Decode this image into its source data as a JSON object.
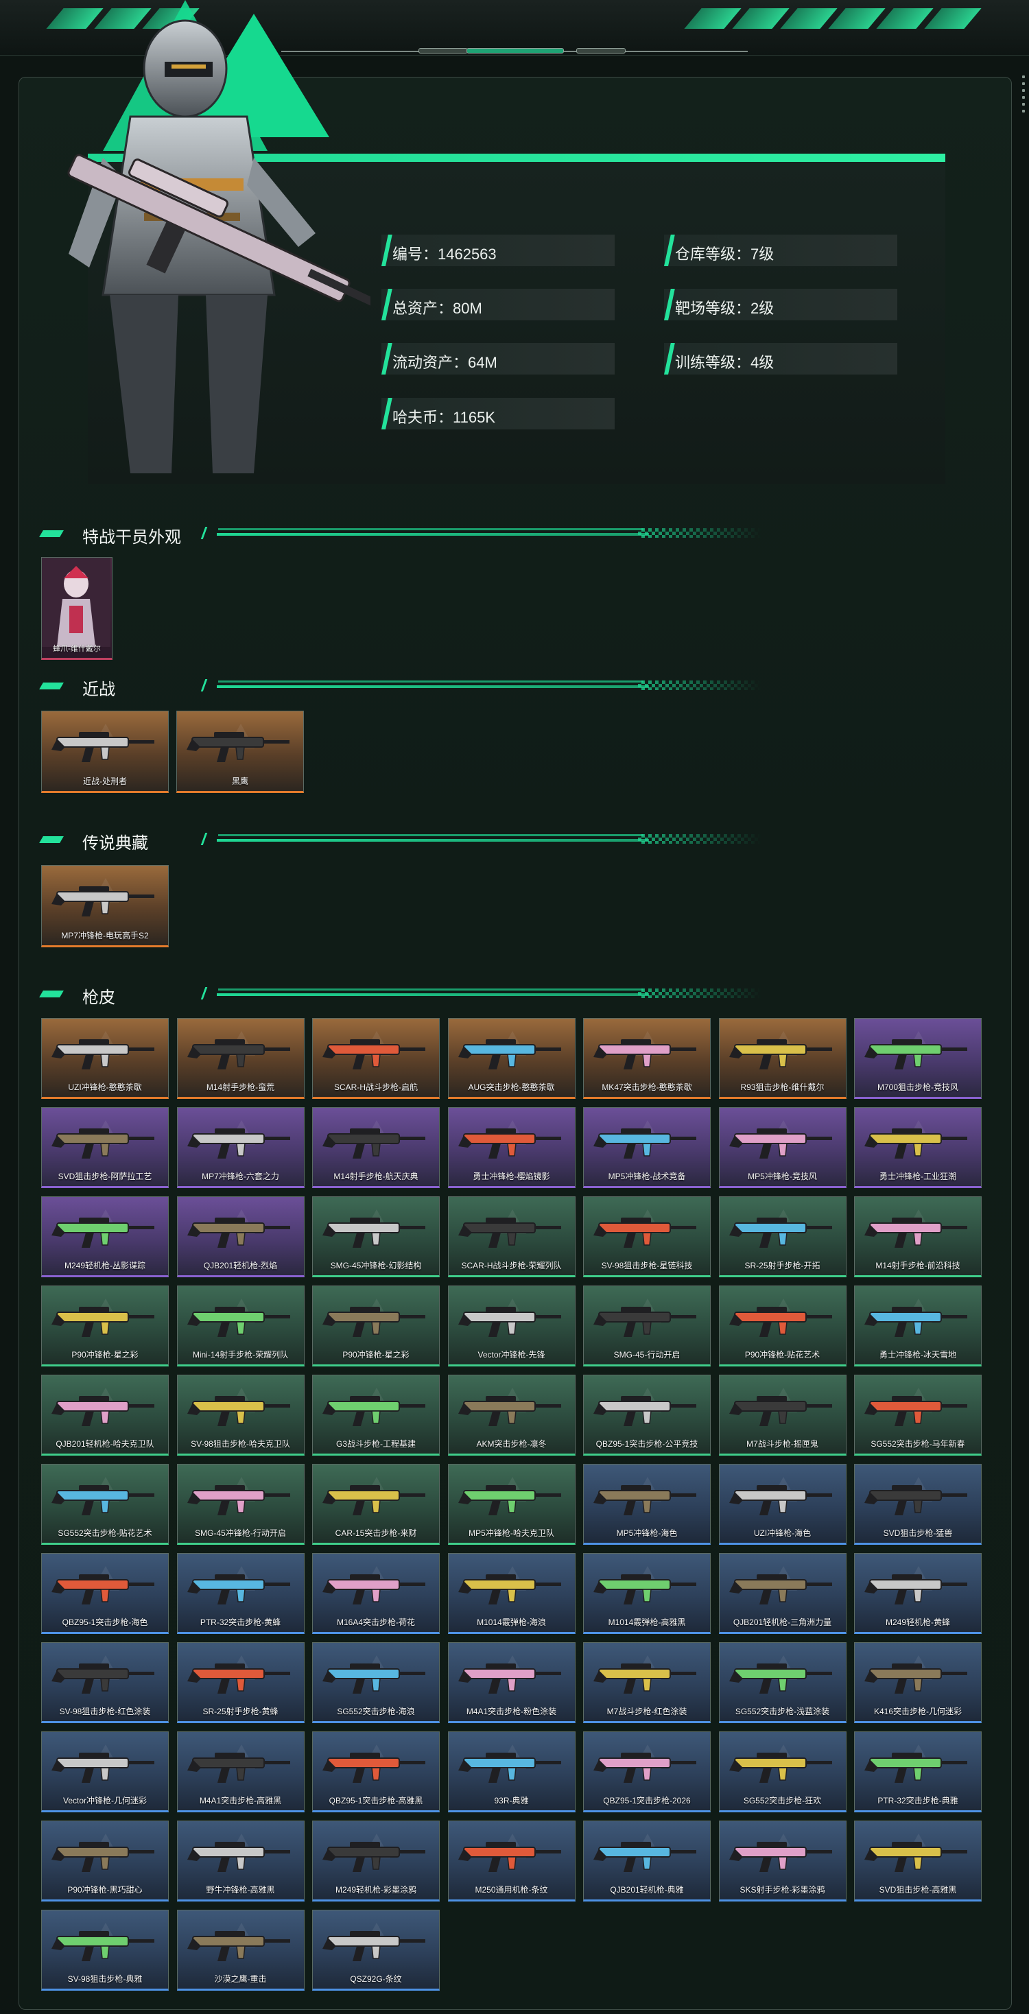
{
  "profile": {
    "id_label": "编号：1462563",
    "total_assets_label": "总资产：80M",
    "liquid_assets_label": "流动资产：64M",
    "havcoin_label": "哈夫币：1165K",
    "warehouse_level_label": "仓库等级：7级",
    "range_level_label": "靶场等级：2级",
    "training_level_label": "训练等级：4级"
  },
  "sections": {
    "operator": "特战干员外观",
    "melee": "近战",
    "legendary": "传说典藏",
    "skins": "枪皮"
  },
  "operator_skins": [
    {
      "name": "蜂爪-维什戴尔",
      "rarity": "operator"
    }
  ],
  "melee_items": [
    {
      "name": "近战-处刑者",
      "rarity": "orange"
    },
    {
      "name": "黑鹰",
      "rarity": "orange"
    }
  ],
  "legendary_items": [
    {
      "name": "MP7冲锋枪-电玩高手S2",
      "rarity": "orange"
    }
  ],
  "gun_skins": [
    {
      "name": "UZI冲锋枪-憨憨茶歇",
      "rarity": "orange"
    },
    {
      "name": "M14射手步枪-蛮荒",
      "rarity": "orange"
    },
    {
      "name": "SCAR-H战斗步枪-启航",
      "rarity": "orange"
    },
    {
      "name": "AUG突击步枪-憨憨茶歇",
      "rarity": "orange"
    },
    {
      "name": "MK47突击步枪-憨憨茶歇",
      "rarity": "orange"
    },
    {
      "name": "R93狙击步枪-维什戴尔",
      "rarity": "orange"
    },
    {
      "name": "M700狙击步枪-竞技风",
      "rarity": "purple"
    },
    {
      "name": "SVD狙击步枪-阿萨拉工艺",
      "rarity": "purple"
    },
    {
      "name": "MP7冲锋枪-六套之力",
      "rarity": "purple"
    },
    {
      "name": "M14射手步枪-航天庆典",
      "rarity": "purple"
    },
    {
      "name": "勇士冲锋枪-樱焰镜影",
      "rarity": "purple"
    },
    {
      "name": "MP5冲锋枪-战术竞备",
      "rarity": "purple"
    },
    {
      "name": "MP5冲锋枪-竞技风",
      "rarity": "purple"
    },
    {
      "name": "勇士冲锋枪-工业狂潮",
      "rarity": "purple"
    },
    {
      "name": "M249轻机枪-丛影谍踪",
      "rarity": "purple"
    },
    {
      "name": "QJB201轻机枪-烈焰",
      "rarity": "purple"
    },
    {
      "name": "SMG-45冲锋枪-幻影结构",
      "rarity": "green"
    },
    {
      "name": "SCAR-H战斗步枪-荣耀列队",
      "rarity": "green"
    },
    {
      "name": "SV-98狙击步枪-星链科技",
      "rarity": "green"
    },
    {
      "name": "SR-25射手步枪-开拓",
      "rarity": "green"
    },
    {
      "name": "M14射手步枪-前沿科技",
      "rarity": "green"
    },
    {
      "name": "P90冲锋枪-星之彩",
      "rarity": "green"
    },
    {
      "name": "Mini-14射手步枪-荣耀列队",
      "rarity": "green"
    },
    {
      "name": "P90冲锋枪-星之彩",
      "rarity": "green"
    },
    {
      "name": "Vector冲锋枪-先锋",
      "rarity": "green"
    },
    {
      "name": "SMG-45-行动开启",
      "rarity": "green"
    },
    {
      "name": "P90冲锋枪-贴花艺术",
      "rarity": "green"
    },
    {
      "name": "勇士冲锋枪-冰天雪地",
      "rarity": "green"
    },
    {
      "name": "QJB201轻机枪-哈夫克卫队",
      "rarity": "green"
    },
    {
      "name": "SV-98狙击步枪-哈夫克卫队",
      "rarity": "green"
    },
    {
      "name": "G3战斗步枪-工程基建",
      "rarity": "green"
    },
    {
      "name": "AKM突击步枪-凛冬",
      "rarity": "green"
    },
    {
      "name": "QBZ95-1突击步枪-公平竞技",
      "rarity": "green"
    },
    {
      "name": "M7战斗步枪-摇匣鬼",
      "rarity": "green"
    },
    {
      "name": "SG552突击步枪-马年新春",
      "rarity": "green"
    },
    {
      "name": "SG552突击步枪-贴花艺术",
      "rarity": "green"
    },
    {
      "name": "SMG-45冲锋枪-行动开启",
      "rarity": "green"
    },
    {
      "name": "CAR-15突击步枪-来财",
      "rarity": "green"
    },
    {
      "name": "MP5冲锋枪-哈夫克卫队",
      "rarity": "green"
    },
    {
      "name": "MP5冲锋枪-海色",
      "rarity": "blue"
    },
    {
      "name": "UZI冲锋枪-海色",
      "rarity": "blue"
    },
    {
      "name": "SVD狙击步枪-猛兽",
      "rarity": "blue"
    },
    {
      "name": "QBZ95-1突击步枪-海色",
      "rarity": "blue"
    },
    {
      "name": "PTR-32突击步枪-黄蜂",
      "rarity": "blue"
    },
    {
      "name": "M16A4突击步枪-荷花",
      "rarity": "blue"
    },
    {
      "name": "M1014霰弹枪-海浪",
      "rarity": "blue"
    },
    {
      "name": "M1014霰弹枪-高雅黑",
      "rarity": "blue"
    },
    {
      "name": "QJB201轻机枪-三角洲力量",
      "rarity": "blue"
    },
    {
      "name": "M249轻机枪-黄蜂",
      "rarity": "blue"
    },
    {
      "name": "SV-98狙击步枪-红色涂装",
      "rarity": "blue"
    },
    {
      "name": "SR-25射手步枪-黄蜂",
      "rarity": "blue"
    },
    {
      "name": "SG552突击步枪-海浪",
      "rarity": "blue"
    },
    {
      "name": "M4A1突击步枪-粉色涂装",
      "rarity": "blue"
    },
    {
      "name": "M7战斗步枪-红色涂装",
      "rarity": "blue"
    },
    {
      "name": "SG552突击步枪-浅蓝涂装",
      "rarity": "blue"
    },
    {
      "name": "K416突击步枪-几何迷彩",
      "rarity": "blue"
    },
    {
      "name": "Vector冲锋枪-几何迷彩",
      "rarity": "blue"
    },
    {
      "name": "M4A1突击步枪-高雅黑",
      "rarity": "blue"
    },
    {
      "name": "QBZ95-1突击步枪-高雅黑",
      "rarity": "blue"
    },
    {
      "name": "93R-典雅",
      "rarity": "blue"
    },
    {
      "name": "QBZ95-1突击步枪-2026",
      "rarity": "blue"
    },
    {
      "name": "SG552突击步枪-狂欢",
      "rarity": "blue"
    },
    {
      "name": "PTR-32突击步枪-典雅",
      "rarity": "blue"
    },
    {
      "name": "P90冲锋枪-黑巧甜心",
      "rarity": "blue"
    },
    {
      "name": "野牛冲锋枪-高雅黑",
      "rarity": "blue"
    },
    {
      "name": "M249轻机枪-彩墨涂鸦",
      "rarity": "blue"
    },
    {
      "name": "M250通用机枪-条纹",
      "rarity": "blue"
    },
    {
      "name": "QJB201轻机枪-典雅",
      "rarity": "blue"
    },
    {
      "name": "SKS射手步枪-彩墨涂鸦",
      "rarity": "blue"
    },
    {
      "name": "SVD狙击步枪-高雅黑",
      "rarity": "blue"
    },
    {
      "name": "SV-98狙击步枪-典雅",
      "rarity": "blue"
    },
    {
      "name": "沙漠之鹰-重击",
      "rarity": "blue"
    },
    {
      "name": "QSZ92G-条纹",
      "rarity": "blue"
    }
  ],
  "colors": {
    "accent": "#23e29b",
    "orange": "#e47b2b",
    "purple": "#8a62d1",
    "green": "#3fcf8b",
    "blue": "#4e93e6"
  }
}
